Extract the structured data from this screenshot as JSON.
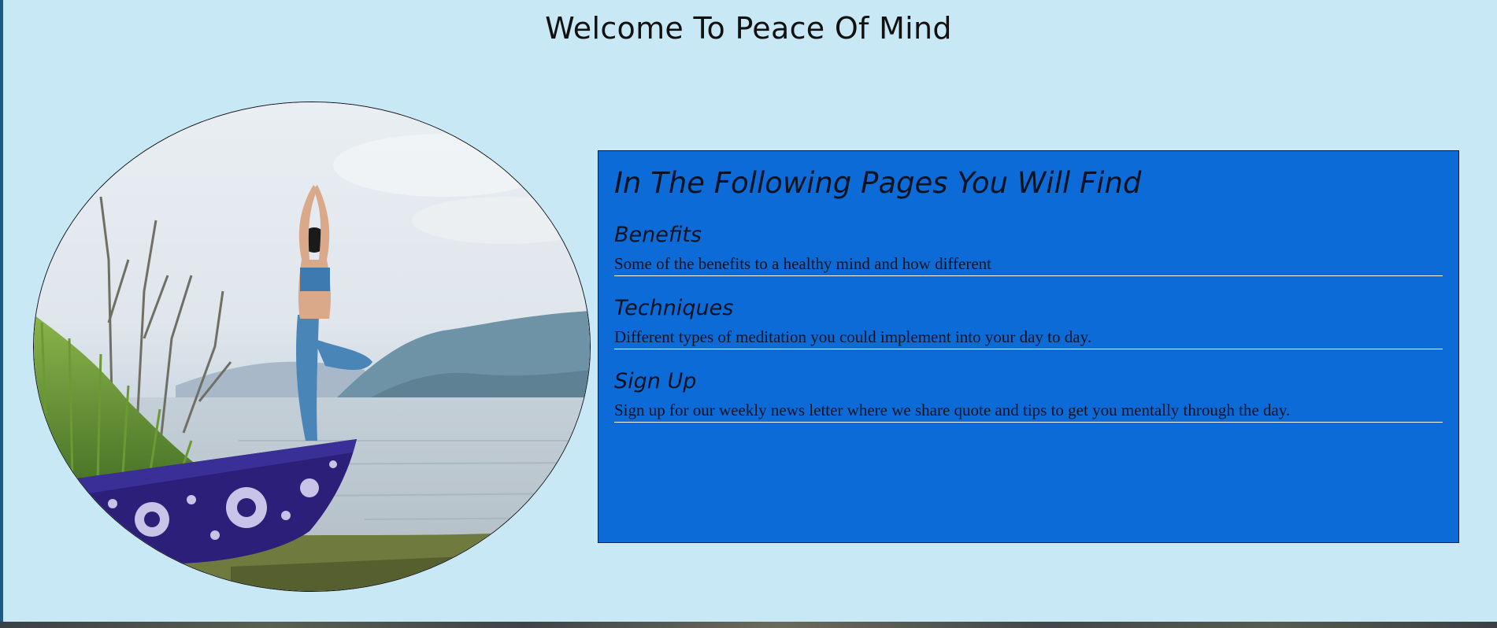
{
  "page": {
    "title": "Welcome To Peace Of Mind",
    "background_color": "#c9e8f5",
    "panel_color": "#0c6bd6"
  },
  "hero_image": {
    "description_icon": "yoga-tree-pose-on-boat-photo"
  },
  "info": {
    "heading": "In The Following Pages You Will Find",
    "sections": [
      {
        "title": "Benefits",
        "text": "Some of the benefits to a healthy mind and how different"
      },
      {
        "title": "Techniques",
        "text": "Different types of meditation you could implement into your day to day."
      },
      {
        "title": "Sign Up",
        "text": "Sign up for our weekly news letter where we share quote and tips to get you mentally through the day."
      }
    ]
  }
}
